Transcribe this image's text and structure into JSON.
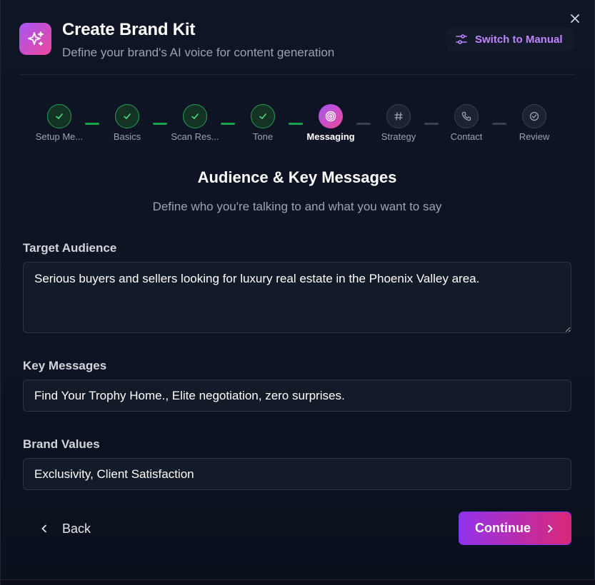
{
  "header": {
    "title": "Create Brand Kit",
    "subtitle": "Define your brand's AI voice for content generation",
    "switch_label": "Switch to Manual"
  },
  "colors": {
    "accent_gradient_start": "#a855f7",
    "accent_gradient_end": "#ec4899",
    "done_green": "#22a055",
    "link_purple": "#c084fc"
  },
  "steps": [
    {
      "label": "Setup Me...",
      "status": "done",
      "icon": "check-icon"
    },
    {
      "label": "Basics",
      "status": "done",
      "icon": "check-icon"
    },
    {
      "label": "Scan Res...",
      "status": "done",
      "icon": "check-icon"
    },
    {
      "label": "Tone",
      "status": "done",
      "icon": "check-icon"
    },
    {
      "label": "Messaging",
      "status": "active",
      "icon": "target-icon"
    },
    {
      "label": "Strategy",
      "status": "todo",
      "icon": "hash-icon"
    },
    {
      "label": "Contact",
      "status": "todo",
      "icon": "phone-icon"
    },
    {
      "label": "Review",
      "status": "todo",
      "icon": "check-circle-icon"
    }
  ],
  "section": {
    "title": "Audience & Key Messages",
    "subtitle": "Define who you're talking to and what you want to say"
  },
  "fields": {
    "target_audience": {
      "label": "Target Audience",
      "value": "Serious buyers and sellers looking for luxury real estate in the Phoenix Valley area."
    },
    "key_messages": {
      "label": "Key Messages",
      "value": "Find Your Trophy Home., Elite negotiation, zero surprises."
    },
    "brand_values": {
      "label": "Brand Values",
      "value": "Exclusivity, Client Satisfaction"
    }
  },
  "footer": {
    "back_label": "Back",
    "continue_label": "Continue"
  }
}
